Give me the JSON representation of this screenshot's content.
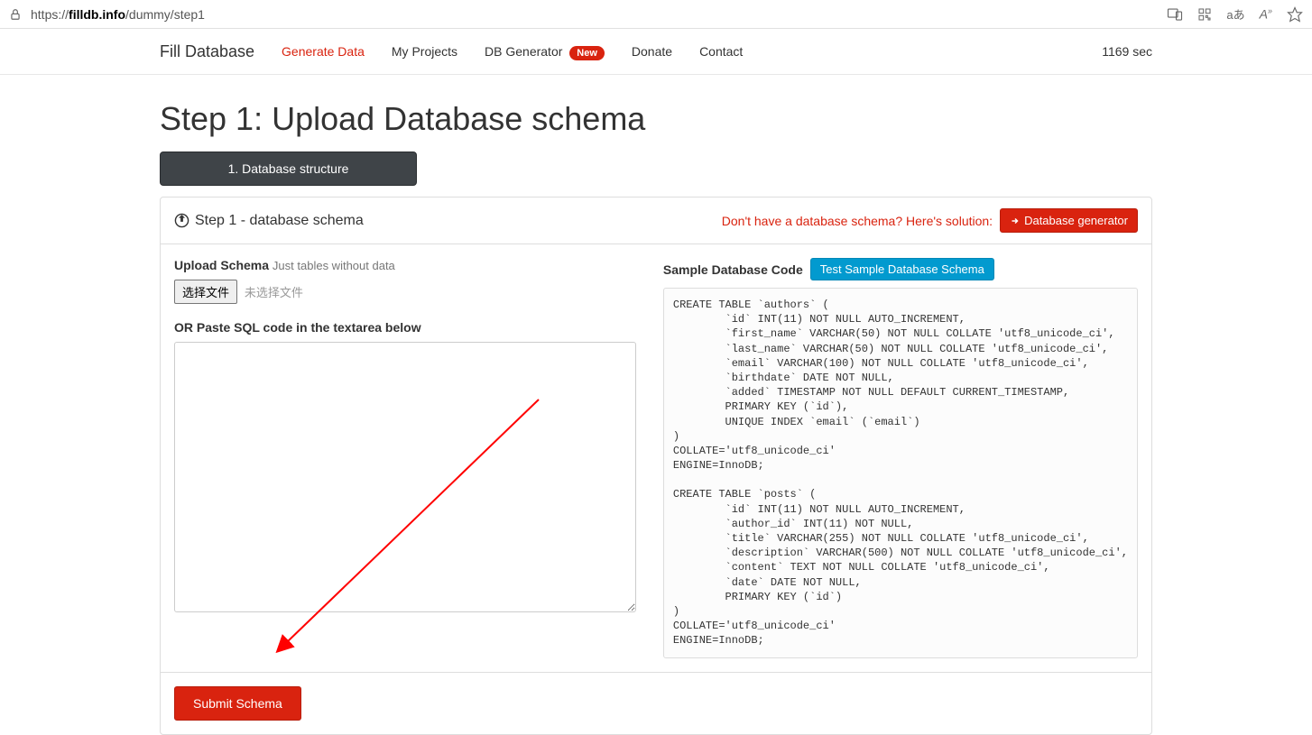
{
  "browser": {
    "url_prefix": "https://",
    "url_host": "filldb.info",
    "url_path": "/dummy/step1"
  },
  "nav": {
    "brand": "Fill Database",
    "links": {
      "generate": "Generate Data",
      "projects": "My Projects",
      "dbgen": "DB Generator",
      "dbgen_badge": "New",
      "donate": "Donate",
      "contact": "Contact"
    },
    "timer": "1169 sec"
  },
  "page": {
    "title": "Step 1: Upload Database schema",
    "step_pill": "1. Database structure",
    "panel_heading": "Step 1 - database schema",
    "no_schema_text": "Don't have a database schema? Here's solution:",
    "db_generator_btn": "Database generator",
    "upload_label": "Upload Schema",
    "upload_hint": "Just tables without data",
    "file_btn": "选择文件",
    "file_status": "未选择文件",
    "paste_label": "OR Paste SQL code in the textarea below",
    "sample_title": "Sample Database Code",
    "test_btn": "Test Sample Database Schema",
    "submit_btn": "Submit Schema",
    "sample_code": "CREATE TABLE `authors` (\n        `id` INT(11) NOT NULL AUTO_INCREMENT,\n        `first_name` VARCHAR(50) NOT NULL COLLATE 'utf8_unicode_ci',\n        `last_name` VARCHAR(50) NOT NULL COLLATE 'utf8_unicode_ci',\n        `email` VARCHAR(100) NOT NULL COLLATE 'utf8_unicode_ci',\n        `birthdate` DATE NOT NULL,\n        `added` TIMESTAMP NOT NULL DEFAULT CURRENT_TIMESTAMP,\n        PRIMARY KEY (`id`),\n        UNIQUE INDEX `email` (`email`)\n)\nCOLLATE='utf8_unicode_ci'\nENGINE=InnoDB;\n\nCREATE TABLE `posts` (\n        `id` INT(11) NOT NULL AUTO_INCREMENT,\n        `author_id` INT(11) NOT NULL,\n        `title` VARCHAR(255) NOT NULL COLLATE 'utf8_unicode_ci',\n        `description` VARCHAR(500) NOT NULL COLLATE 'utf8_unicode_ci',\n        `content` TEXT NOT NULL COLLATE 'utf8_unicode_ci',\n        `date` DATE NOT NULL,\n        PRIMARY KEY (`id`)\n)\nCOLLATE='utf8_unicode_ci'\nENGINE=InnoDB;"
  }
}
